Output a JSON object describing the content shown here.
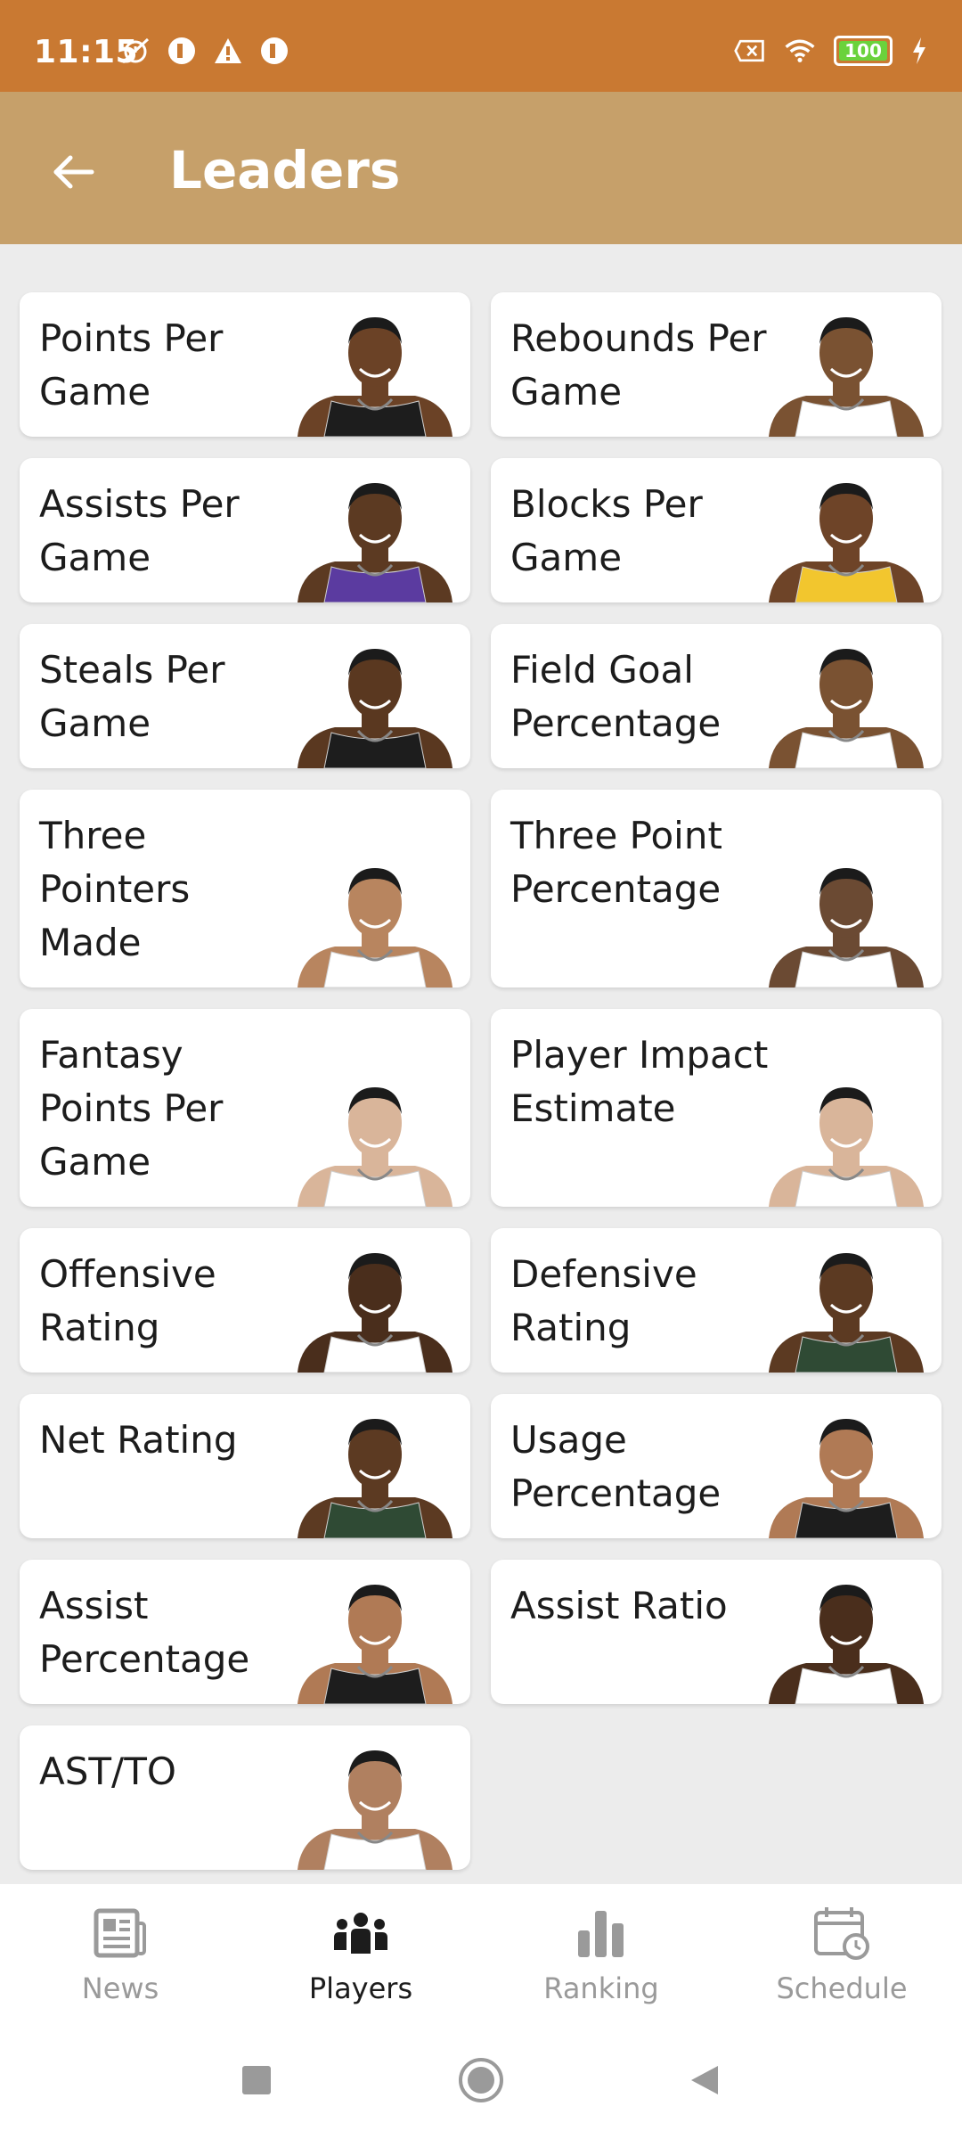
{
  "status_bar": {
    "time": "11:15",
    "battery": "100",
    "left_icons": [
      "mute-alarm-icon",
      "app-icon",
      "warning-icon",
      "app-icon"
    ],
    "right_icons": [
      "x-box-icon",
      "wifi-icon",
      "battery-icon",
      "charging-icon"
    ]
  },
  "app_bar": {
    "title": "Leaders"
  },
  "cards": [
    {
      "label": "Points Per Game",
      "jersey": "#1d1d1d"
    },
    {
      "label": "Rebounds Per Game",
      "jersey": "#ffffff"
    },
    {
      "label": "Assists Per Game",
      "jersey": "#5b3ba0"
    },
    {
      "label": "Blocks Per Game",
      "jersey": "#f2c62e"
    },
    {
      "label": "Steals Per Game",
      "jersey": "#1d1d1d"
    },
    {
      "label": "Field Goal Percentage",
      "jersey": "#ffffff"
    },
    {
      "label": "Three Pointers Made",
      "jersey": "#ffffff"
    },
    {
      "label": "Three Point Percentage",
      "jersey": "#ffffff"
    },
    {
      "label": "Fantasy Points Per Game",
      "jersey": "#ffffff"
    },
    {
      "label": "Player Impact Estimate",
      "jersey": "#ffffff"
    },
    {
      "label": "Offensive Rating",
      "jersey": "#ffffff"
    },
    {
      "label": "Defensive Rating",
      "jersey": "#2f4a34"
    },
    {
      "label": "Net Rating",
      "jersey": "#2f4a34"
    },
    {
      "label": "Usage Percentage",
      "jersey": "#1d1d1d"
    },
    {
      "label": "Assist Percentage",
      "jersey": "#1d1d1d"
    },
    {
      "label": "Assist Ratio",
      "jersey": "#ffffff"
    },
    {
      "label": "AST/TO",
      "jersey": "#ffffff"
    }
  ],
  "bottom_nav": [
    {
      "label": "News",
      "icon": "newspaper-icon",
      "active": false
    },
    {
      "label": "Players",
      "icon": "players-icon",
      "active": true
    },
    {
      "label": "Ranking",
      "icon": "bar-chart-icon",
      "active": false
    },
    {
      "label": "Schedule",
      "icon": "calendar-icon",
      "active": false
    }
  ],
  "system_nav": [
    "square-icon",
    "circle-icon",
    "back-triangle-icon"
  ],
  "colors": {
    "status_bar": "#c97932",
    "app_bar": "#c6a06a",
    "background": "#ececec",
    "nav_active": "#1c1c1c",
    "nav_inactive": "#9a9a9a"
  }
}
